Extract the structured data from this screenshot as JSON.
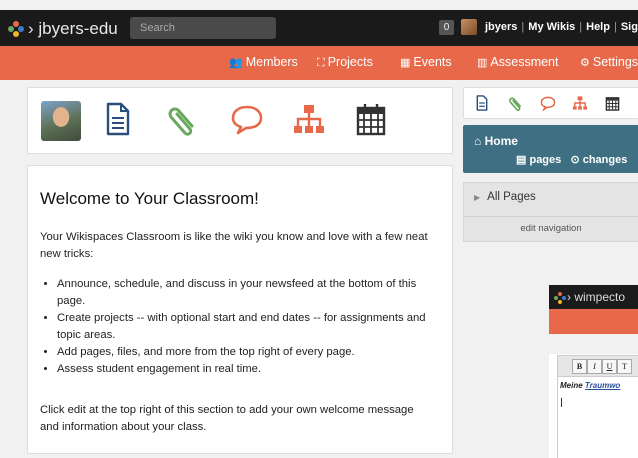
{
  "topbar": {
    "wiki_title": "› jbyers-edu",
    "search_placeholder": "Search",
    "notification_count": "0",
    "username": "jbyers",
    "my_wikis": "My Wikis",
    "help": "Help",
    "sign_out": "Sign Out"
  },
  "nav": {
    "items": [
      {
        "label": "Members",
        "icon": "members-icon"
      },
      {
        "label": "Projects",
        "icon": "projects-icon"
      },
      {
        "label": "Events",
        "icon": "calendar-icon"
      },
      {
        "label": "Assessment",
        "icon": "assessment-icon"
      },
      {
        "label": "Settings",
        "icon": "gear-icon"
      }
    ]
  },
  "toolbar_icons": [
    "avatar",
    "page-icon",
    "paperclip-icon",
    "comment-icon",
    "sitemap-icon",
    "calendar-icon"
  ],
  "welcome": {
    "title": "Welcome to Your Classroom!",
    "intro": "Your Wikispaces Classroom is like the wiki you know and love with a few neat new tricks:",
    "bullets": [
      "Announce, schedule, and discuss in your newsfeed at the bottom of this page.",
      "Create projects -- with optional start and end dates -- for assignments and topic areas.",
      "Add pages, files, and more from the top right of every page.",
      "Assess student engagement in real time."
    ],
    "footer": "Click edit at the top right of this section to add your own welcome message and information about your class."
  },
  "sidebar": {
    "home_label": "Home",
    "pages_link": "pages",
    "changes_link": "changes",
    "all_pages": "All Pages",
    "edit_navigation": "edit navigation"
  },
  "second_window": {
    "title": "› wimpecto",
    "editor_text_prefix": "Meine ",
    "editor_text_link": "Traumwo",
    "toolbar_buttons": [
      "B",
      "I",
      "U",
      "T"
    ]
  },
  "colors": {
    "topbar": "#1a1a1a",
    "nav_orange": "#e8694a",
    "home_teal": "#3f6f82",
    "icon_blue": "#2a4f7e",
    "icon_green": "#6aa85f",
    "icon_orange": "#e8694a",
    "icon_dark": "#333333"
  }
}
